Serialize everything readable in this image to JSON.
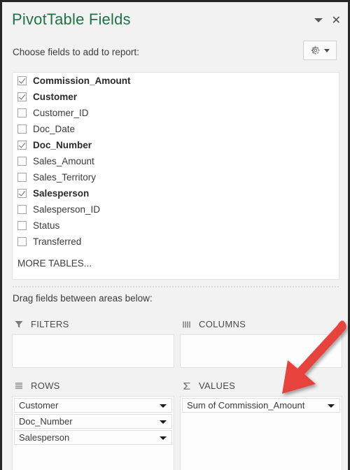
{
  "panel": {
    "title": "PivotTable Fields",
    "collapse_icon": "chevron-down-icon",
    "close_label": "✕",
    "accent_color": "#1f7246"
  },
  "choose": {
    "label": "Choose fields to add to report:",
    "tools_icon": "gear-icon",
    "tools_caret_icon": "chevron-down-icon"
  },
  "fields": {
    "items": [
      {
        "label": "Commission_Amount",
        "checked": true
      },
      {
        "label": "Customer",
        "checked": true
      },
      {
        "label": "Customer_ID",
        "checked": false
      },
      {
        "label": "Doc_Date",
        "checked": false
      },
      {
        "label": "Doc_Number",
        "checked": true
      },
      {
        "label": "Sales_Amount",
        "checked": false
      },
      {
        "label": "Sales_Territory",
        "checked": false
      },
      {
        "label": "Salesperson",
        "checked": true
      },
      {
        "label": "Salesperson_ID",
        "checked": false
      },
      {
        "label": "Status",
        "checked": false
      },
      {
        "label": "Transferred",
        "checked": false
      }
    ],
    "more_tables_label": "MORE TABLES..."
  },
  "areas": {
    "instruction": "Drag fields between areas below:",
    "filters": {
      "label": "FILTERS",
      "icon": "funnel-icon",
      "items": []
    },
    "columns": {
      "label": "COLUMNS",
      "icon": "columns-icon",
      "items": []
    },
    "rows": {
      "label": "ROWS",
      "icon": "rows-icon",
      "items": [
        {
          "label": "Customer"
        },
        {
          "label": "Doc_Number"
        },
        {
          "label": "Salesperson"
        }
      ]
    },
    "values": {
      "label": "VALUES",
      "icon": "sigma-icon",
      "items": [
        {
          "label": "Sum of Commission_Amount"
        }
      ]
    }
  },
  "annotation": {
    "arrow_icon": "red-arrow-icon",
    "color": "#e8433c"
  }
}
